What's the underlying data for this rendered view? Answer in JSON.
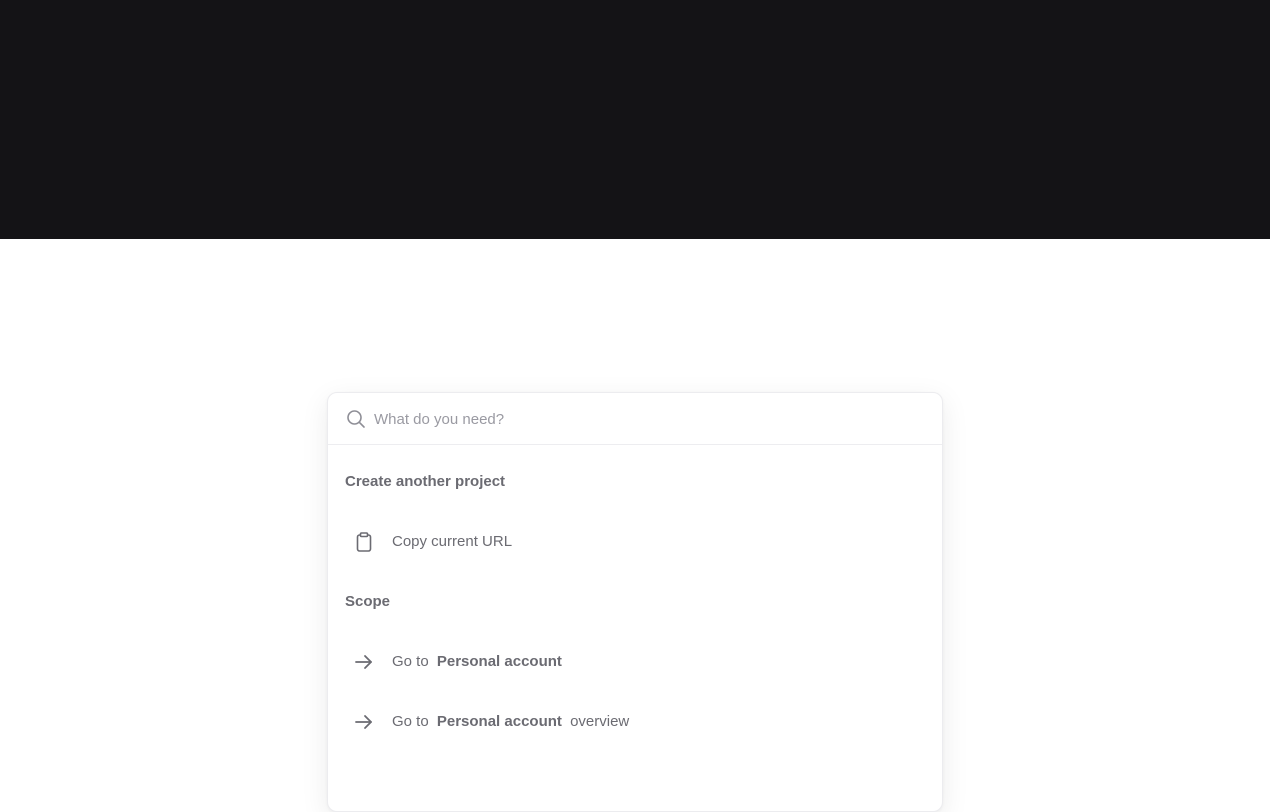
{
  "search": {
    "placeholder": "What do you need?"
  },
  "sections": [
    {
      "heading": "Create another project",
      "items": [
        {
          "icon": "clipboard-icon",
          "label": "Copy current URL"
        }
      ]
    },
    {
      "heading": "Scope",
      "items": [
        {
          "icon": "arrow-right-icon",
          "prefix": "Go to",
          "strong": "Personal account",
          "suffix": ""
        },
        {
          "icon": "arrow-right-icon",
          "prefix": "Go to",
          "strong": "Personal account",
          "suffix": "overview"
        }
      ]
    }
  ],
  "colors": {
    "top_band": "#141316",
    "text": "#6b6b72",
    "placeholder": "#9a9aa2"
  }
}
